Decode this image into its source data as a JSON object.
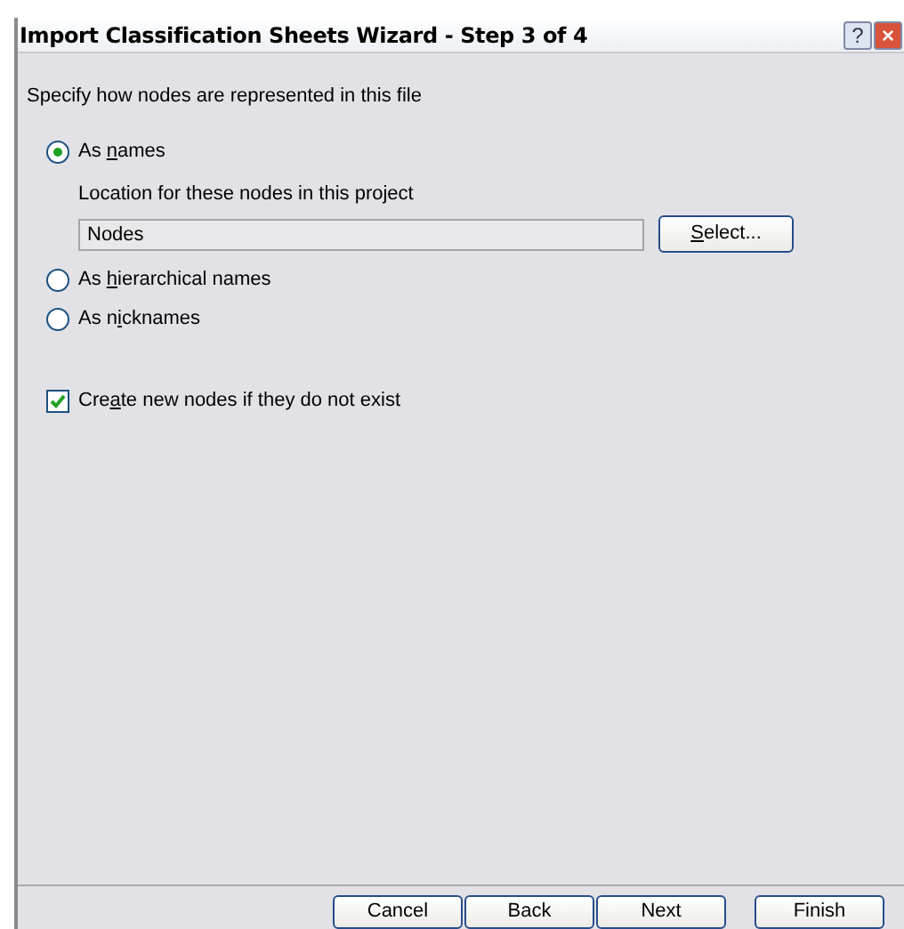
{
  "window": {
    "title": "Import Classification Sheets Wizard - Step 3 of 4"
  },
  "title_buttons": [
    {
      "kind": "help",
      "label": "?"
    },
    {
      "kind": "close",
      "label": "×"
    }
  ],
  "prompt": "Specify how nodes are represented in this file",
  "options": [
    {
      "pre": "As ",
      "key": "n",
      "post": "ames",
      "selected": true,
      "location": {
        "label": "Location for these nodes in this project",
        "value": "Nodes",
        "button": {
          "key": "S",
          "post": "elect..."
        }
      }
    },
    {
      "pre": "As ",
      "key": "h",
      "post": "ierarchical names",
      "selected": false
    },
    {
      "pre": "As n",
      "key": "i",
      "post": "cknames",
      "selected": false
    }
  ],
  "checkbox": {
    "pre": "Cre",
    "key": "a",
    "post": "te new nodes if they do not exist",
    "checked": true
  },
  "buttons": [
    {
      "label": "Cancel"
    },
    {
      "label": "Back"
    },
    {
      "label": "Next"
    },
    {
      "label": "Finish"
    }
  ]
}
